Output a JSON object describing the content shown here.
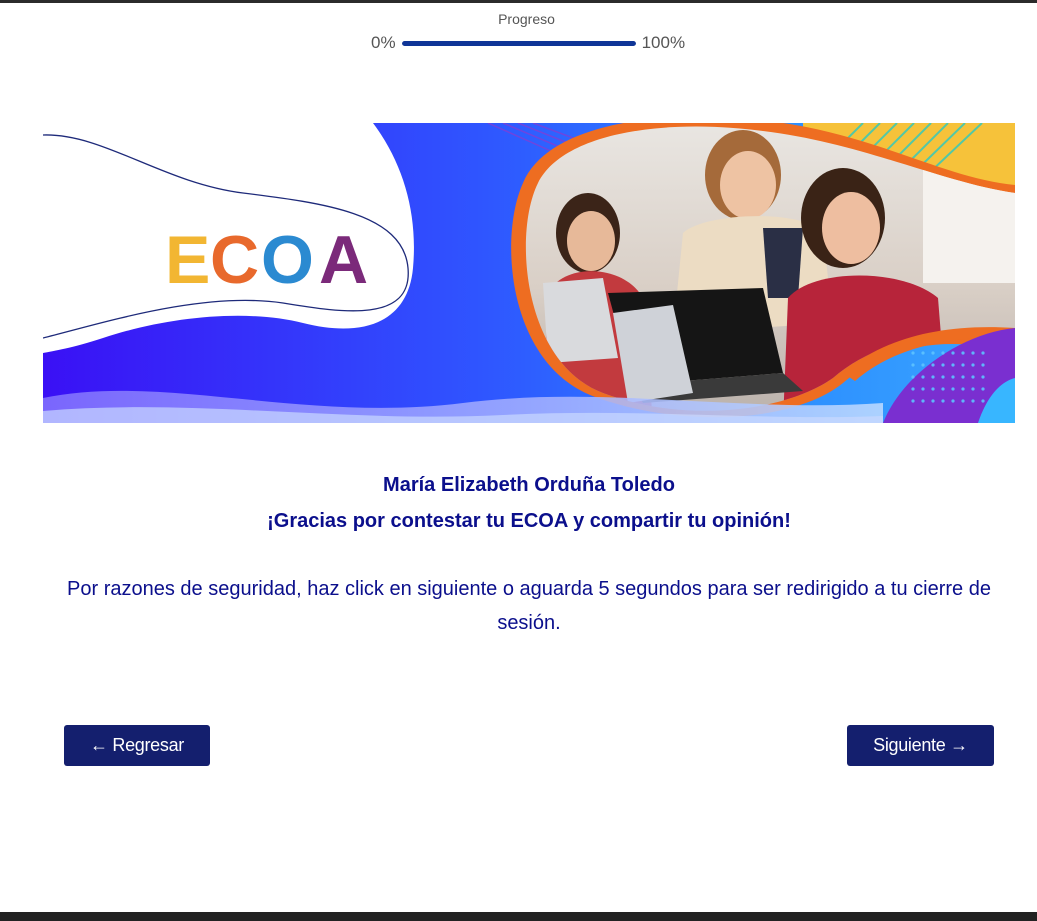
{
  "progress": {
    "title": "Progreso",
    "min_label": "0%",
    "max_label": "100%",
    "value": 1.0,
    "bar_color": "#0f3597"
  },
  "banner": {
    "logo_letters": [
      "E",
      "C",
      "O",
      "A"
    ],
    "logo_colors": [
      "#f2b632",
      "#e8692c",
      "#2b8ad1",
      "#7b2a7a"
    ],
    "image_description": "three people smiling at laptops"
  },
  "message": {
    "student_name": "María Elizabeth Orduña Toledo",
    "thanks": "¡Gracias por contestar tu ECOA y compartir tu opinión!",
    "notice": "Por razones de seguridad, haz click en siguiente o aguarda 5 segundos para ser redirigido a tu cierre de sesión.",
    "text_color": "#0b0f8c"
  },
  "nav": {
    "back_label": "← Regresar",
    "next_label": "Siguiente →",
    "button_color": "#141f6e"
  }
}
